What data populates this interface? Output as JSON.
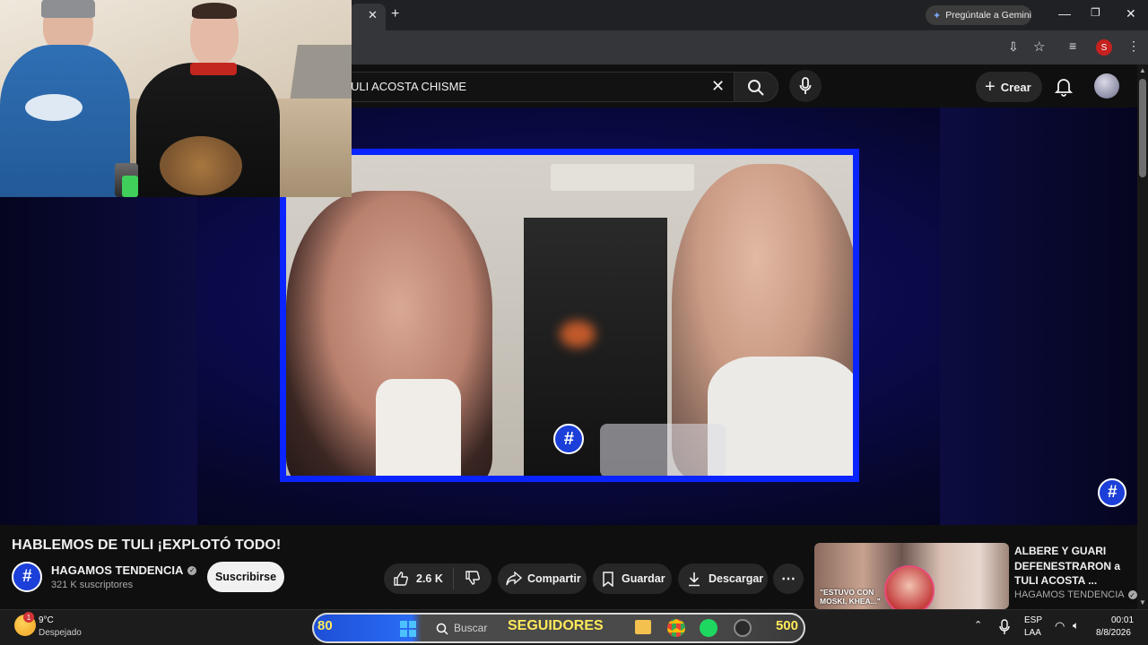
{
  "browser": {
    "gemini_label": "Pregúntale a Gemini",
    "profile_letter": "S"
  },
  "youtube": {
    "search_value": "ULI ACOSTA CHISME",
    "create_label": "Crear"
  },
  "video": {
    "title": "HABLEMOS DE TULI ¡EXPLOTÓ TODO!",
    "channel_name": "HAGAMOS TENDENCIA",
    "subscribers": "321 K suscriptores",
    "subscribe_label": "Suscribirse",
    "likes": "2.6 K",
    "share_label": "Compartir",
    "save_label": "Guardar",
    "download_label": "Descargar"
  },
  "recommended": {
    "title": "ALBERE Y GUARI DEFENESTRARON a TULI ACOSTA ...",
    "channel": "HAGAMOS TENDENCIA",
    "thumb_caption": "\"ESTUVO CON MOSKI, KHEA...\""
  },
  "taskbar": {
    "weather_temp": "9°C",
    "weather_desc": "Despejado",
    "search_placeholder": "Buscar",
    "stream_left_count": "80",
    "stream_label": "SEGUIDORES",
    "stream_right_count": "500",
    "lang_1": "ESP",
    "lang_2": "LAA",
    "time": "00:01",
    "date": "8/8/2026"
  },
  "colors": {
    "frame_border": "#0a24ff",
    "accent_blue": "#1d4fd6",
    "subscribe_bg": "#f1f1f1",
    "verified": "#aaaaaa"
  }
}
